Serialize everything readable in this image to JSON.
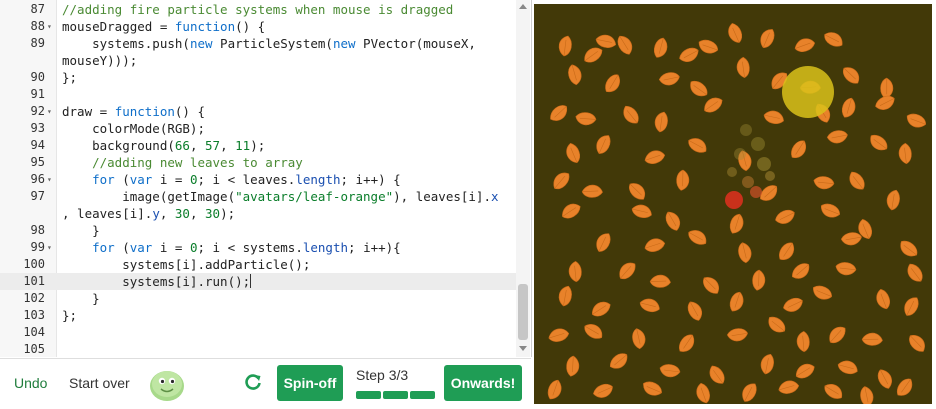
{
  "editor": {
    "lines": [
      {
        "n": "87",
        "fold": false,
        "tokens": [
          {
            "t": "//adding fire particle systems when mouse is dragged",
            "c": "cm"
          }
        ]
      },
      {
        "n": "88",
        "fold": true,
        "tokens": [
          {
            "t": "mouseDragged = ",
            "c": ""
          },
          {
            "t": "function",
            "c": "kw"
          },
          {
            "t": "() {",
            "c": ""
          }
        ]
      },
      {
        "n": "89",
        "fold": false,
        "tokens": [
          {
            "t": "    systems.push(",
            "c": ""
          },
          {
            "t": "new",
            "c": "kw"
          },
          {
            "t": " ParticleSystem(",
            "c": ""
          },
          {
            "t": "new",
            "c": "kw"
          },
          {
            "t": " PVector(mouseX,",
            "c": ""
          }
        ]
      },
      {
        "n": "",
        "fold": false,
        "tokens": [
          {
            "t": "mouseY)));",
            "c": ""
          }
        ]
      },
      {
        "n": "90",
        "fold": false,
        "tokens": [
          {
            "t": "};",
            "c": ""
          }
        ]
      },
      {
        "n": "91",
        "fold": false,
        "tokens": []
      },
      {
        "n": "92",
        "fold": true,
        "tokens": [
          {
            "t": "draw = ",
            "c": ""
          },
          {
            "t": "function",
            "c": "kw"
          },
          {
            "t": "() {",
            "c": ""
          }
        ]
      },
      {
        "n": "93",
        "fold": false,
        "tokens": [
          {
            "t": "    colorMode(RGB);",
            "c": ""
          }
        ]
      },
      {
        "n": "94",
        "fold": false,
        "tokens": [
          {
            "t": "    background(",
            "c": ""
          },
          {
            "t": "66",
            "c": "num"
          },
          {
            "t": ", ",
            "c": ""
          },
          {
            "t": "57",
            "c": "num"
          },
          {
            "t": ", ",
            "c": ""
          },
          {
            "t": "11",
            "c": "num"
          },
          {
            "t": ");",
            "c": ""
          }
        ]
      },
      {
        "n": "95",
        "fold": false,
        "tokens": [
          {
            "t": "    //adding new leaves to array",
            "c": "cm"
          }
        ]
      },
      {
        "n": "96",
        "fold": true,
        "tokens": [
          {
            "t": "    ",
            "c": ""
          },
          {
            "t": "for",
            "c": "kw"
          },
          {
            "t": " (",
            "c": ""
          },
          {
            "t": "var",
            "c": "kw"
          },
          {
            "t": " i = ",
            "c": ""
          },
          {
            "t": "0",
            "c": "num"
          },
          {
            "t": "; i < leaves.",
            "c": ""
          },
          {
            "t": "length",
            "c": "prop"
          },
          {
            "t": "; i++) {",
            "c": ""
          }
        ]
      },
      {
        "n": "97",
        "fold": false,
        "tokens": [
          {
            "t": "        image(getImage(",
            "c": ""
          },
          {
            "t": "\"avatars/leaf-orange\"",
            "c": "str"
          },
          {
            "t": "), leaves[i].",
            "c": ""
          },
          {
            "t": "x",
            "c": "prop"
          }
        ]
      },
      {
        "n": "",
        "fold": false,
        "tokens": [
          {
            "t": ", leaves[i].",
            "c": ""
          },
          {
            "t": "y",
            "c": "prop"
          },
          {
            "t": ", ",
            "c": ""
          },
          {
            "t": "30",
            "c": "num"
          },
          {
            "t": ", ",
            "c": ""
          },
          {
            "t": "30",
            "c": "num"
          },
          {
            "t": ");",
            "c": ""
          }
        ]
      },
      {
        "n": "98",
        "fold": false,
        "tokens": [
          {
            "t": "    }",
            "c": ""
          }
        ]
      },
      {
        "n": "99",
        "fold": true,
        "tokens": [
          {
            "t": "    ",
            "c": ""
          },
          {
            "t": "for",
            "c": "kw"
          },
          {
            "t": " (",
            "c": ""
          },
          {
            "t": "var",
            "c": "kw"
          },
          {
            "t": " i = ",
            "c": ""
          },
          {
            "t": "0",
            "c": "num"
          },
          {
            "t": "; i < systems.",
            "c": ""
          },
          {
            "t": "length",
            "c": "prop"
          },
          {
            "t": "; i++){",
            "c": ""
          }
        ]
      },
      {
        "n": "100",
        "fold": false,
        "tokens": [
          {
            "t": "        systems[i].addParticle();",
            "c": ""
          }
        ]
      },
      {
        "n": "101",
        "fold": false,
        "active": true,
        "cursor": true,
        "tokens": [
          {
            "t": "        systems[i].run();",
            "c": ""
          }
        ]
      },
      {
        "n": "102",
        "fold": false,
        "tokens": [
          {
            "t": "    }",
            "c": ""
          }
        ]
      },
      {
        "n": "103",
        "fold": false,
        "tokens": [
          {
            "t": "};",
            "c": ""
          }
        ]
      },
      {
        "n": "104",
        "fold": false,
        "tokens": []
      },
      {
        "n": "105",
        "fold": false,
        "tokens": []
      }
    ]
  },
  "toolbar": {
    "undo_label": "Undo",
    "start_over_label": "Start over",
    "spinoff_label": "Spin-off",
    "step_label": "Step 3/3",
    "onwards_label": "Onwards!",
    "progress_steps_completed": 3,
    "progress_steps_total": 3,
    "accent_color": "#1f9d55"
  },
  "canvas": {
    "background_color": "#423908",
    "leaf_color": "#e8822a"
  }
}
